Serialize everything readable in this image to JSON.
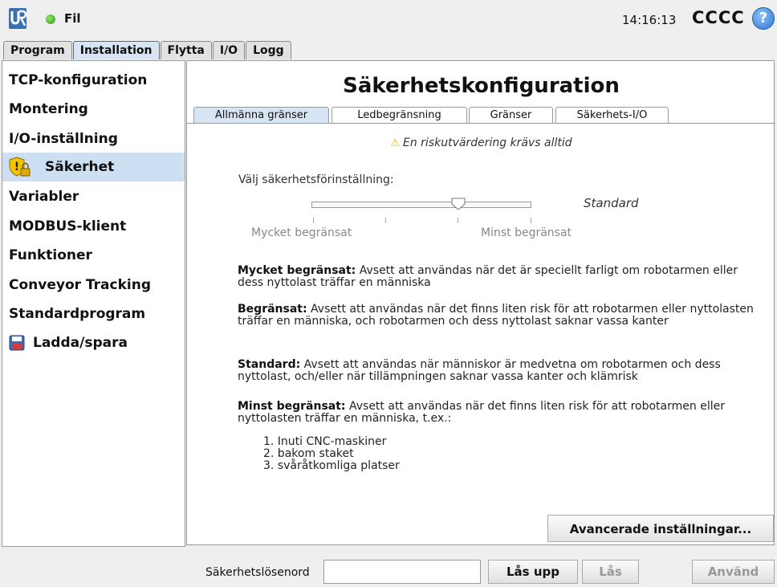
{
  "topbar": {
    "file_label": "Fil",
    "clock": "14:16:13",
    "user": "CCCC",
    "help_glyph": "?"
  },
  "main_tabs": [
    "Program",
    "Installation",
    "Flytta",
    "I/O",
    "Logg"
  ],
  "sidebar": {
    "items": [
      {
        "label": "TCP-konfiguration"
      },
      {
        "label": "Montering"
      },
      {
        "label": "I/O-inställning"
      },
      {
        "label": "Säkerhet",
        "icon": "shield-lock-icon"
      },
      {
        "label": "Variabler"
      },
      {
        "label": "MODBUS-klient"
      },
      {
        "label": "Funktioner"
      },
      {
        "label": "Conveyor Tracking"
      },
      {
        "label": "Standardprogram"
      },
      {
        "label": "Ladda/spara",
        "icon": "floppy-icon"
      }
    ]
  },
  "content": {
    "title": "Säkerhetskonfiguration",
    "tabs": [
      "Allmänna gränser",
      "Ledbegränsning",
      "Gränser",
      "Säkerhets-I/O"
    ],
    "warning": "En riskutvärdering krävs alltid",
    "preset_label": "Välj säkerhetsförinställning:",
    "slider_value": "Standard",
    "range_low": "Mycket begränsat",
    "range_high": "Minst begränsat",
    "descriptions": [
      {
        "term": "Mycket begränsat:",
        "text": " Avsett att användas när det är speciellt farligt om robotarmen eller dess nyttolast träffar en människa"
      },
      {
        "term": "Begränsat:",
        "text": " Avsett att användas när det finns liten risk för att robotarmen eller nyttolasten träffar en människa, och robotarmen och dess nyttolast saknar vassa kanter"
      },
      {
        "term": "Standard:",
        "text": " Avsett att användas när människor är medvetna om robotarmen och dess nyttolast, och/eller när tillämpningen saknar vassa kanter och klämrisk"
      },
      {
        "term": "Minst begränsat:",
        "text": " Avsett att användas när det finns liten risk för att robotarmen eller nyttolasten träffar en människa, t.ex.:"
      }
    ],
    "list": [
      "1. Inuti CNC-maskiner",
      "2. bakom staket",
      "3. svåråtkomliga platser"
    ],
    "advanced_button": "Avancerade inställningar..."
  },
  "footer": {
    "password_label": "Säkerhetslösenord",
    "password_value": "",
    "unlock": "Lås upp",
    "lock": "Lås",
    "apply": "Använd"
  }
}
